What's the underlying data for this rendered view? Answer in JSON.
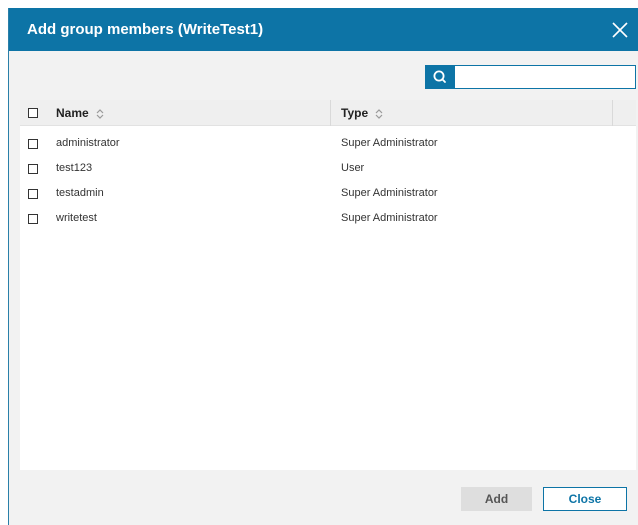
{
  "dialog": {
    "title": "Add group members (WriteTest1)",
    "search": {
      "value": "",
      "placeholder": ""
    },
    "table": {
      "columns": [
        {
          "key": "name",
          "label": "Name"
        },
        {
          "key": "type",
          "label": "Type"
        }
      ],
      "rows": [
        {
          "name": "administrator",
          "type": "Super Administrator"
        },
        {
          "name": "test123",
          "type": "User"
        },
        {
          "name": "testadmin",
          "type": "Super Administrator"
        },
        {
          "name": "writetest",
          "type": "Super Administrator"
        }
      ]
    },
    "buttons": {
      "add_label": "Add",
      "close_label": "Close"
    }
  },
  "colors": {
    "header_bg": "#0d74a6",
    "accent": "#0d74a6",
    "dialog_bg": "#f2f2f2"
  }
}
